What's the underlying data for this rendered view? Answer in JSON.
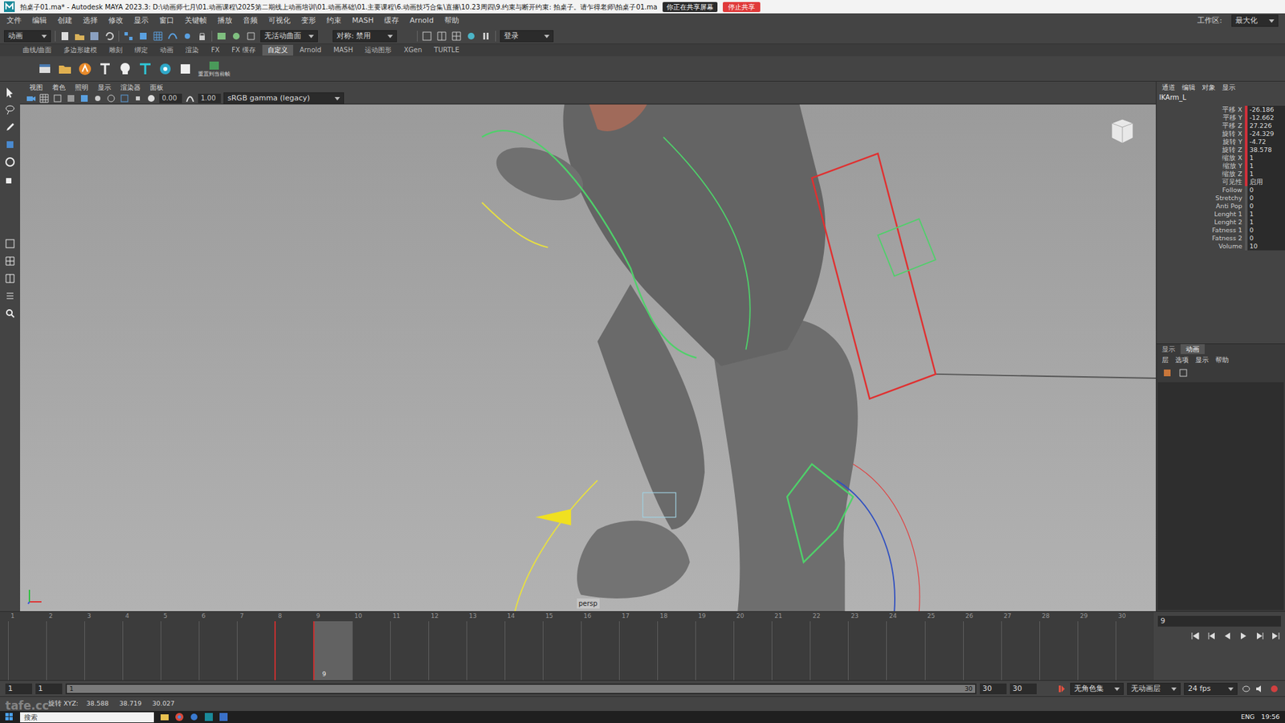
{
  "window": {
    "title": "拍桌子01.ma* - Autodesk MAYA 2023.3: D:\\动画师七月\\01.动画课程\\2025第二期线上动画培训\\01.动画基础\\01.主要课程\\6.动画技巧合集\\直播\\10.23周四\\9.约束与断开约束: 拍桌子。请乍得老师\\拍桌子01.ma",
    "sharing": "你正在共享屏幕",
    "stop_sharing": "停止共享"
  },
  "menu": [
    "文件",
    "编辑",
    "创建",
    "选择",
    "修改",
    "显示",
    "窗口",
    "关键帧",
    "播放",
    "音频",
    "可视化",
    "变形",
    "约束",
    "MASH",
    "缓存",
    "Arnold",
    "帮助"
  ],
  "workspace": {
    "label": "工作区:",
    "value": "最大化"
  },
  "status_line": {
    "mode": "动画",
    "surface": "无活动曲面",
    "symmetry": "对称: 禁用",
    "login": "登录"
  },
  "shelf": {
    "tabs": [
      {
        "label": "曲线/曲面",
        "selected": false
      },
      {
        "label": "多边形建模",
        "selected": false
      },
      {
        "label": "雕刻",
        "selected": false
      },
      {
        "label": "绑定",
        "selected": false
      },
      {
        "label": "动画",
        "selected": false
      },
      {
        "label": "渲染",
        "selected": false
      },
      {
        "label": "FX",
        "selected": false
      },
      {
        "label": "FX 缓存",
        "selected": false
      },
      {
        "label": "自定义",
        "selected": true
      },
      {
        "label": "Arnold",
        "selected": false
      },
      {
        "label": "MASH",
        "selected": false
      },
      {
        "label": "运动图形",
        "selected": false
      },
      {
        "label": "XGen",
        "selected": false
      },
      {
        "label": "TURTLE",
        "selected": false
      }
    ],
    "button_label": "重置到当前帧"
  },
  "viewport": {
    "menu": [
      "视图",
      "着色",
      "照明",
      "显示",
      "渲染器",
      "面板"
    ],
    "exposure": "0.00",
    "gamma": "1.00",
    "color_space": "sRGB gamma (legacy)",
    "camera": "persp"
  },
  "channel_box": {
    "menu": [
      "通道",
      "编辑",
      "对象",
      "显示"
    ],
    "object": "IKArm_L",
    "channels": [
      {
        "name": "平移 X",
        "value": "-26.186",
        "keyed": true
      },
      {
        "name": "平移 Y",
        "value": "-12.662",
        "keyed": true
      },
      {
        "name": "平移 Z",
        "value": "27.226",
        "keyed": true
      },
      {
        "name": "旋转 X",
        "value": "-24.329",
        "keyed": true
      },
      {
        "name": "旋转 Y",
        "value": "-4.72",
        "keyed": true
      },
      {
        "name": "旋转 Z",
        "value": "38.578",
        "keyed": true
      },
      {
        "name": "缩放 X",
        "value": "1",
        "keyed": true
      },
      {
        "name": "缩放 Y",
        "value": "1",
        "keyed": true
      },
      {
        "name": "缩放 Z",
        "value": "1",
        "keyed": true
      },
      {
        "name": "可见性",
        "value": "启用",
        "keyed": true
      },
      {
        "name": "Follow",
        "value": "0",
        "keyed": false
      },
      {
        "name": "Stretchy",
        "value": "0",
        "keyed": false
      },
      {
        "name": "Anti Pop",
        "value": "0",
        "keyed": false
      },
      {
        "name": "Lenght 1",
        "value": "1",
        "keyed": false
      },
      {
        "name": "Lenght 2",
        "value": "1",
        "keyed": false
      },
      {
        "name": "Fatness 1",
        "value": "0",
        "keyed": false
      },
      {
        "name": "Fatness 2",
        "value": "0",
        "keyed": false
      },
      {
        "name": "Volume",
        "value": "10",
        "keyed": false
      }
    ]
  },
  "layer_editor": {
    "tabs": [
      {
        "label": "显示",
        "selected": false
      },
      {
        "label": "动画",
        "selected": true
      }
    ],
    "menu": [
      "层",
      "选项",
      "显示",
      "帮助"
    ]
  },
  "timeline": {
    "current_frame": "9",
    "ticks": [
      {
        "label": "1",
        "current": false,
        "key": false
      },
      {
        "label": "2",
        "current": false,
        "key": false
      },
      {
        "label": "3",
        "current": false,
        "key": false
      },
      {
        "label": "4",
        "current": false,
        "key": false
      },
      {
        "label": "5",
        "current": false,
        "key": false
      },
      {
        "label": "6",
        "current": false,
        "key": false
      },
      {
        "label": "7",
        "current": false,
        "key": false
      },
      {
        "label": "8",
        "current": false,
        "key": true
      },
      {
        "label": "9",
        "current": true,
        "key": true
      },
      {
        "label": "10",
        "current": false,
        "key": false
      },
      {
        "label": "11",
        "current": false,
        "key": false
      },
      {
        "label": "12",
        "current": false,
        "key": false
      },
      {
        "label": "13",
        "current": false,
        "key": false
      },
      {
        "label": "14",
        "current": false,
        "key": false
      },
      {
        "label": "15",
        "current": false,
        "key": false
      },
      {
        "label": "16",
        "current": false,
        "key": false
      },
      {
        "label": "17",
        "current": false,
        "key": false
      },
      {
        "label": "18",
        "current": false,
        "key": false
      },
      {
        "label": "19",
        "current": false,
        "key": false
      },
      {
        "label": "20",
        "current": false,
        "key": false
      },
      {
        "label": "21",
        "current": false,
        "key": false
      },
      {
        "label": "22",
        "current": false,
        "key": false
      },
      {
        "label": "23",
        "current": false,
        "key": false
      },
      {
        "label": "24",
        "current": false,
        "key": false
      },
      {
        "label": "25",
        "current": false,
        "key": false
      },
      {
        "label": "26",
        "current": false,
        "key": false
      },
      {
        "label": "27",
        "current": false,
        "key": false
      },
      {
        "label": "28",
        "current": false,
        "key": false
      },
      {
        "label": "29",
        "current": false,
        "key": false
      },
      {
        "label": "30",
        "current": false,
        "key": false
      }
    ]
  },
  "range": {
    "start": "1",
    "inner_start": "1",
    "bar_start": "1",
    "bar_end": "30",
    "inner_end": "30",
    "end": "30",
    "character_set": "无角色集",
    "anim_layer": "无动画层",
    "fps": "24 fps"
  },
  "command_line": {
    "label": "旋转 XYZ:",
    "values": [
      "38.588",
      "38.719",
      "30.027"
    ]
  },
  "watermark": "tafe.cc",
  "taskbar": {
    "search": "搜索",
    "lang": "ENG",
    "time": "19:56"
  }
}
